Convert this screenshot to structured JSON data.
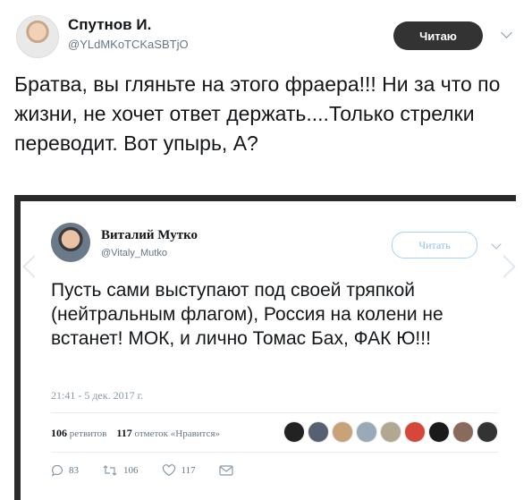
{
  "tweet": {
    "author_name": "Спутнов И.",
    "author_handle": "@YLdMKoTCKaSBTjO",
    "follow_label": "Читаю",
    "text": "Братва, вы гляньте на этого фраера!!! Ни за что по жизни, не хочет ответ держать....Только стрелки переводит. Вот упырь, А?"
  },
  "quoted": {
    "author_name": "Виталий Мутко",
    "author_handle": "@Vitaly_Mutko",
    "follow_label": "Читать",
    "text": "Пусть сами выступают под своей тряпкой (нейтральным флагом), Россия на колени не встанет! МОК, и лично Томас Бах, ФАК Ю!!!",
    "timestamp": "21:41 - 5 дек. 2017 г.",
    "retweets_count": "106",
    "retweets_label": "ретвитов",
    "likes_count": "117",
    "likes_label": "отметок «Нравится»",
    "liker_colors": [
      "#222222",
      "#556070",
      "#c9a27a",
      "#9aa9b8",
      "#b0a890",
      "#d4473a",
      "#1a1a1a",
      "#8a6a5a",
      "#333333"
    ],
    "actions": {
      "reply_count": "83",
      "retweet_count": "106",
      "like_count": "117"
    }
  }
}
